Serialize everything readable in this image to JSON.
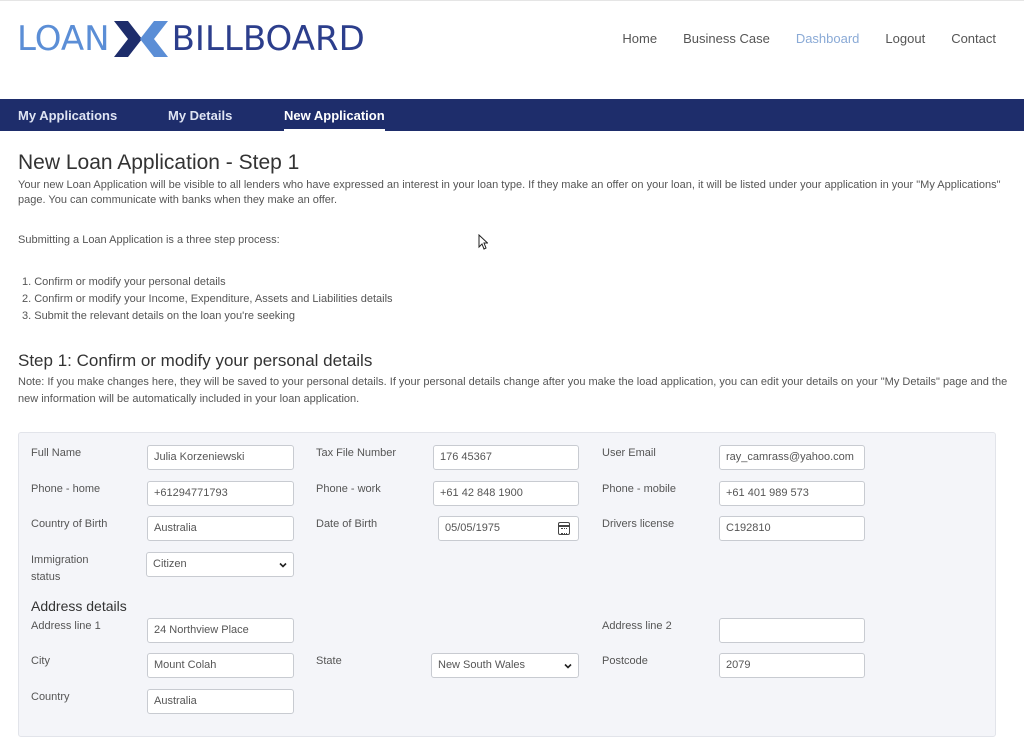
{
  "brand": {
    "part1": "LOAN",
    "part2": "BILLBOARD",
    "colors": {
      "primary_dark": "#1e2d6b",
      "primary_light": "#5b8ed6",
      "nav_active": "#8aaad6"
    }
  },
  "top_nav": {
    "home": "Home",
    "business_case": "Business Case",
    "dashboard": "Dashboard",
    "logout": "Logout",
    "contact": "Contact"
  },
  "sub_nav": {
    "my_applications": "My Applications",
    "my_details": "My Details",
    "new_application": "New Application"
  },
  "page": {
    "title": "New Loan Application - Step 1",
    "intro": "Your new Loan Application will be visible to all lenders who have expressed an interest in your loan type. If they make an offer on your loan, it will be listed under your application in your \"My Applications\" page. You can communicate with banks when they make an offer.",
    "process": "Submitting a Loan Application is a three step process:",
    "steps": [
      "1. Confirm or modify your personal details",
      "2. Confirm or modify your Income, Expenditure, Assets and Liabilities details",
      "3. Submit the relevant details on the loan you're seeking"
    ],
    "step_heading": "Step 1: Confirm or modify your personal details",
    "note": "Note: If you make changes here, they will be saved to your personal details. If your personal details change after you make the load application, you can edit your details on your \"My Details\" page and the new information will be automatically included in your loan application."
  },
  "form": {
    "full_name": {
      "label": "Full Name",
      "value": "Julia Korzeniewski"
    },
    "tax_file_number": {
      "label": "Tax File Number",
      "value": "176 45367"
    },
    "user_email": {
      "label": "User Email",
      "value": "ray_camrass@yahoo.com"
    },
    "phone_home": {
      "label": "Phone - home",
      "value": "+61294771793"
    },
    "phone_work": {
      "label": "Phone - work",
      "value": "+61 42 848 1900"
    },
    "phone_mobile": {
      "label": "Phone - mobile",
      "value": "+61 401 989 573"
    },
    "country_of_birth": {
      "label": "Country of Birth",
      "value": "Australia"
    },
    "date_of_birth": {
      "label": "Date of Birth",
      "value": "05/05/1975"
    },
    "drivers_license": {
      "label": "Drivers license",
      "value": "C192810"
    },
    "immigration_status": {
      "label_line1": "Immigration",
      "label_line2": "status",
      "value": "Citizen"
    },
    "address_heading": "Address details",
    "address_line1": {
      "label": "Address line 1",
      "value": "24 Northview Place"
    },
    "address_line2": {
      "label": "Address line 2",
      "value": ""
    },
    "city": {
      "label": "City",
      "value": "Mount Colah"
    },
    "state": {
      "label": "State",
      "value": "New South Wales"
    },
    "postcode": {
      "label": "Postcode",
      "value": "2079"
    },
    "country": {
      "label": "Country",
      "value": "Australia"
    }
  }
}
